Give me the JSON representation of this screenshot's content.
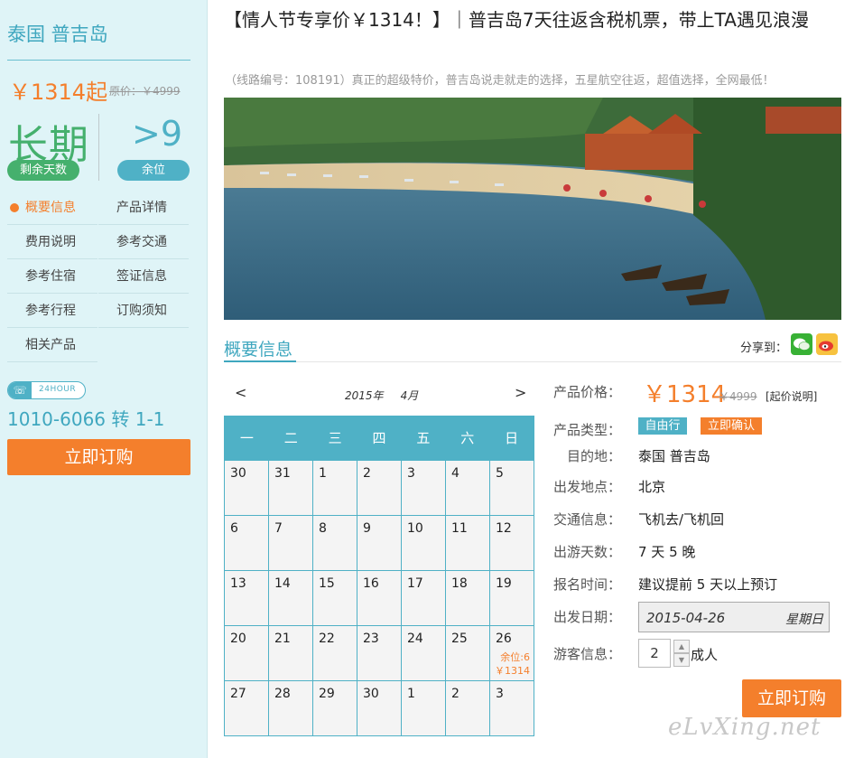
{
  "sidebar": {
    "destination": "泰国 普吉岛",
    "price_from": "￥1314起",
    "original_price": "原价：￥4999",
    "remaining_days_value": "长期",
    "remaining_days_label": "剩余天数",
    "seats_value": ">9",
    "seats_label": "余位",
    "nav": [
      {
        "label": "概要信息"
      },
      {
        "label": "产品详情"
      },
      {
        "label": "费用说明"
      },
      {
        "label": "参考交通"
      },
      {
        "label": "参考住宿"
      },
      {
        "label": "签证信息"
      },
      {
        "label": "参考行程"
      },
      {
        "label": "订购须知"
      },
      {
        "label": "相关产品"
      }
    ],
    "hotline_badge": "24HOUR",
    "hotline": "1010-6066 转 1-1",
    "book_button": "立即订购"
  },
  "header": {
    "title": "【情人节专享价￥1314！】｜普吉岛7天往返含税机票，带上TA遇见浪漫",
    "subtitle": "（线路编号：108191）真正的超级特价，普吉岛说走就走的选择，五星航空往返，超值选择，全网最低！"
  },
  "section": {
    "title": "概要信息",
    "share_label": "分享到："
  },
  "calendar": {
    "prev": "<",
    "next": ">",
    "year": "2015年",
    "month": "4月",
    "weekdays": [
      "一",
      "二",
      "三",
      "四",
      "五",
      "六",
      "日"
    ],
    "weeks": [
      [
        "30",
        "31",
        "1",
        "2",
        "3",
        "4",
        "5"
      ],
      [
        "6",
        "7",
        "8",
        "9",
        "10",
        "11",
        "12"
      ],
      [
        "13",
        "14",
        "15",
        "16",
        "17",
        "18",
        "19"
      ],
      [
        "20",
        "21",
        "22",
        "23",
        "24",
        "25",
        "26"
      ],
      [
        "27",
        "28",
        "29",
        "30",
        "1",
        "2",
        "3"
      ]
    ],
    "special": {
      "seats": "余位:6",
      "price": "￥1314"
    }
  },
  "info": {
    "price_label": "产品价格：",
    "price": "￥1314",
    "price_orig": "￥4999",
    "price_note": "[起价说明]",
    "type_label": "产品类型：",
    "tag1": "自由行",
    "tag2": "立即确认",
    "dest_label": "目的地：",
    "dest": "泰国 普吉岛",
    "from_label": "出发地点：",
    "from": "北京",
    "traffic_label": "交通信息：",
    "traffic": "飞机去/飞机回",
    "days_label": "出游天数：",
    "days": "7 天 5 晚",
    "signup_label": "报名时间：",
    "signup": "建议提前 5 天以上预订",
    "date_label": "出发日期：",
    "date": "2015-04-26",
    "date_weekday": "星期日",
    "guest_label": "游客信息：",
    "guest_qty": "2",
    "guest_unit": "成人",
    "book_button": "立即订购"
  },
  "watermark": "eLvXing.net",
  "colors": {
    "accent_blue": "#4fb1c6",
    "accent_orange": "#f47f2c",
    "accent_green": "#45b06d",
    "sidebar_bg": "#dff4f7"
  }
}
